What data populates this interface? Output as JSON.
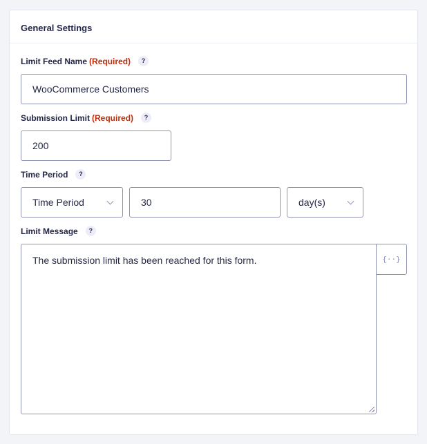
{
  "section": {
    "title": "General Settings"
  },
  "fields": {
    "limit_feed_name": {
      "label": "Limit Feed Name",
      "required": "(Required)",
      "help": "?",
      "value": "WooCommerce Customers"
    },
    "submission_limit": {
      "label": "Submission Limit",
      "required": "(Required)",
      "help": "?",
      "value": "200"
    },
    "time_period": {
      "label": "Time Period",
      "help": "?",
      "type_select": "Time Period",
      "amount": "30",
      "unit_select": "day(s)"
    },
    "limit_message": {
      "label": "Limit Message",
      "help": "?",
      "value": "The submission limit has been reached for this form.",
      "merge_tag_glyph": "{··}"
    }
  },
  "icons": {
    "help": "question-icon",
    "chevron": "chevron-down-icon",
    "merge_tags": "merge-tags-icon",
    "resize": "resize-handle-icon"
  },
  "colors": {
    "required": "#c02b0a",
    "label": "#242748",
    "border": "#9092b2",
    "help_bg": "#ecedf8"
  }
}
